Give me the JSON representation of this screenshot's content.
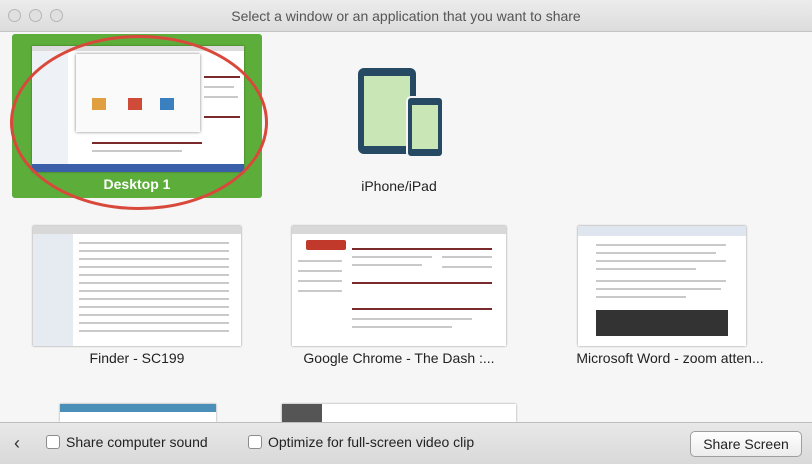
{
  "window": {
    "title": "Select a window or an application that you want to share"
  },
  "tiles": {
    "desktop": {
      "label": "Desktop 1",
      "selected": true,
      "accent": "#5cad3a",
      "highlight": "#d9493b"
    },
    "ios": {
      "label": "iPhone/iPad",
      "icon": "ipad-iphone-icon"
    },
    "finder": {
      "label": "Finder - SC199"
    },
    "chrome": {
      "label": "Google Chrome - The Dash :..."
    },
    "word": {
      "label": "Microsoft Word - zoom atten..."
    }
  },
  "bottom": {
    "back_icon": "chevron-left-icon",
    "back": "‹",
    "share_sound": "Share computer sound",
    "optimize_video": "Optimize for full-screen video clip",
    "share_screen": "Share Screen"
  }
}
